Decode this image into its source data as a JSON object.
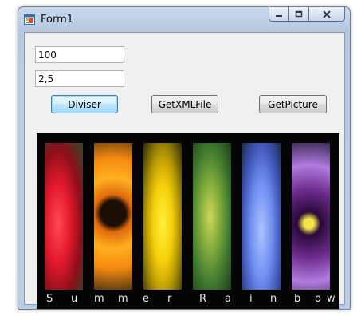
{
  "window": {
    "title": "Form1",
    "icon": "winforms-app-icon",
    "controls": {
      "minimize_icon": "minimize-icon",
      "maximize_icon": "maximize-icon",
      "close_icon": "close-icon"
    }
  },
  "form": {
    "textbox1_value": "100",
    "textbox2_value": "2,5",
    "buttons": {
      "diviser": "Diviser",
      "get_xml_file": "GetXMLFile",
      "get_picture": "GetPicture"
    }
  },
  "picture": {
    "caption_letters": [
      "S",
      "u",
      "m",
      "m",
      "e",
      "r",
      "R",
      "a",
      "i",
      "n",
      "b",
      "o",
      "w"
    ],
    "strips": [
      "red-dahlia",
      "orange-sunflower",
      "yellow-flower-with-bee",
      "green-seed-pod",
      "blue-ageratum",
      "purple-pansy"
    ]
  },
  "colors": {
    "accent_button_border": "#3c7fb1",
    "title_bar": "#b9cde6",
    "client_bg": "#f0f0f0"
  }
}
